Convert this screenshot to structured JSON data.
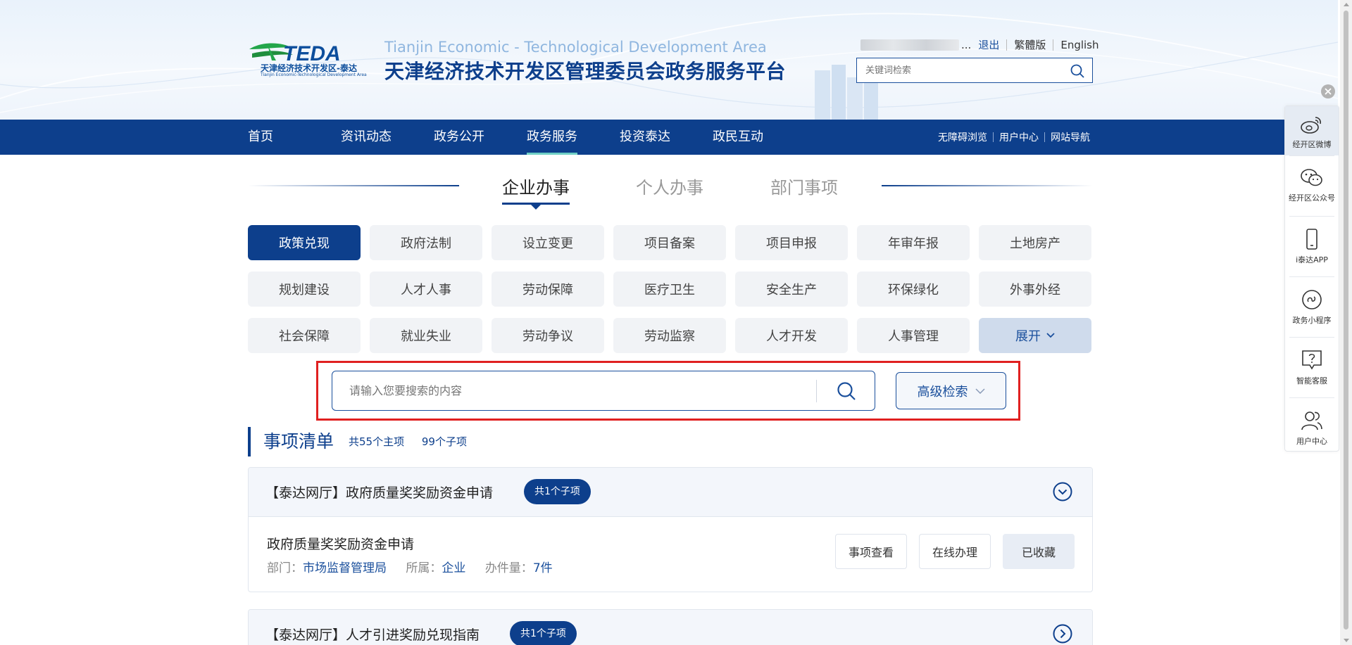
{
  "header": {
    "logo": {
      "mark_text": "TEDA",
      "cn": "天津经济技术开发区-泰达",
      "en": "Tianjin Economic-Technological Development Area"
    },
    "site_name_en": "Tianjin Economic - Technological Development Area",
    "site_name_cn": "天津经济技术开发区管理委员会政务服务平台",
    "user_suffix": "...",
    "links": {
      "logout": "退出",
      "traditional": "繁體版",
      "english": "English"
    },
    "search_placeholder": "关键词检索"
  },
  "nav": {
    "items": [
      {
        "label": "首页"
      },
      {
        "label": "资讯动态"
      },
      {
        "label": "政务公开"
      },
      {
        "label": "政务服务"
      },
      {
        "label": "投资泰达"
      },
      {
        "label": "政民互动"
      }
    ],
    "active_index": 3,
    "right_links": [
      "无障碍浏览",
      "用户中心",
      "网站导航"
    ]
  },
  "categories": {
    "tabs": [
      "企业办事",
      "个人办事",
      "部门事项"
    ],
    "active_index": 0
  },
  "service_grid": {
    "items": [
      "政策兑现",
      "政府法制",
      "设立变更",
      "项目备案",
      "项目申报",
      "年审年报",
      "土地房产",
      "规划建设",
      "人才人事",
      "劳动保障",
      "医疗卫生",
      "安全生产",
      "环保绿化",
      "外事外经",
      "社会保障",
      "就业失业",
      "劳动争议",
      "劳动监察",
      "人才开发",
      "人事管理"
    ],
    "active_index": 0,
    "expand_label": "展开"
  },
  "search": {
    "placeholder": "请输入您要搜索的内容",
    "advanced_label": "高级检索"
  },
  "item_list": {
    "title": "事项清单",
    "main_count_text": "共55个主项",
    "sub_count_text": "99个子项",
    "cards": [
      {
        "title": "【泰达网厅】政府质量奖奖励资金申请",
        "badge": "共1个子项",
        "expanded": true,
        "sub": {
          "name": "政府质量奖奖励资金申请",
          "dept_label": "部门：",
          "dept": "市场监督管理局",
          "belong_label": "所属：",
          "belong": "企业",
          "count_label": "办件量：",
          "count": "7件",
          "buttons": {
            "view": "事项查看",
            "online": "在线办理",
            "fav": "已收藏"
          }
        }
      },
      {
        "title": "【泰达网厅】人才引进奖励兑现指南",
        "badge": "共1个子项",
        "expanded": false
      }
    ]
  },
  "side_panel": {
    "items": [
      {
        "label": "经开区微博",
        "icon": "weibo-icon"
      },
      {
        "label": "经开区公众号",
        "icon": "wechat-icon"
      },
      {
        "label": "i泰达APP",
        "icon": "mobile-icon"
      },
      {
        "label": "政务小程序",
        "icon": "mini-program-icon"
      },
      {
        "label": "智能客服",
        "icon": "help-icon"
      },
      {
        "label": "用户中心",
        "icon": "users-icon"
      }
    ],
    "active_index": 0
  },
  "colors": {
    "primary": "#0d3f8c",
    "accent_link": "#1a4f9c",
    "highlight_frame": "#e02020",
    "nav_underline": "#6fd0c6"
  }
}
